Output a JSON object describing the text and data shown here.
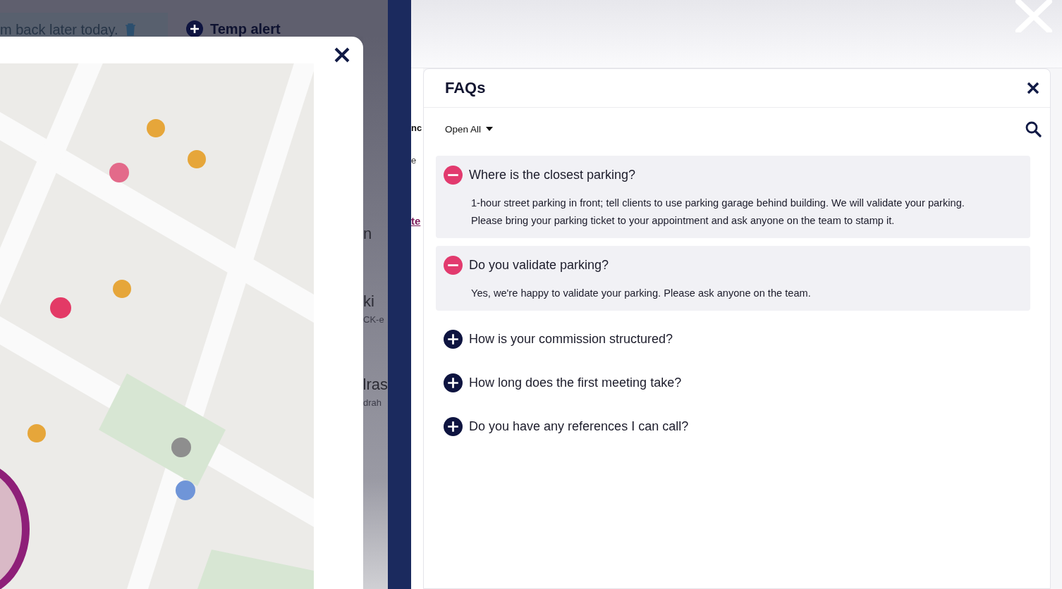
{
  "alert": {
    "text": "m back later today.",
    "temp_alert": "Temp alert"
  },
  "strip_fragments": [
    {
      "kind": "title",
      "text": "n"
    },
    {
      "kind": "title",
      "text": "ki"
    },
    {
      "kind": "sub",
      "text": "CK-e"
    },
    {
      "kind": "title",
      "text": "lras"
    },
    {
      "kind": "sub",
      "text": "drah"
    }
  ],
  "side_fragments": [
    {
      "kind": "heading",
      "text": "nc"
    },
    {
      "kind": "small",
      "text": "e"
    },
    {
      "kind": "link",
      "text": "te"
    }
  ],
  "faq": {
    "title": "FAQs",
    "open_all": "Open All",
    "items": [
      {
        "question": "Where is the closest parking?",
        "answer": "1-hour street parking in front; tell clients to use parking garage behind building. We will validate your parking. Please bring your parking ticket to your appointment and ask anyone on the team to stamp it.",
        "expanded": true
      },
      {
        "question": "Do you validate parking?",
        "answer": "Yes, we're happy to validate your parking. Please ask anyone on the team.",
        "expanded": true
      },
      {
        "question": "How is your commission structured?",
        "expanded": false
      },
      {
        "question": "How long does the first meeting take?",
        "expanded": false
      },
      {
        "question": "Do you have any references I can call?",
        "expanded": false
      }
    ]
  }
}
